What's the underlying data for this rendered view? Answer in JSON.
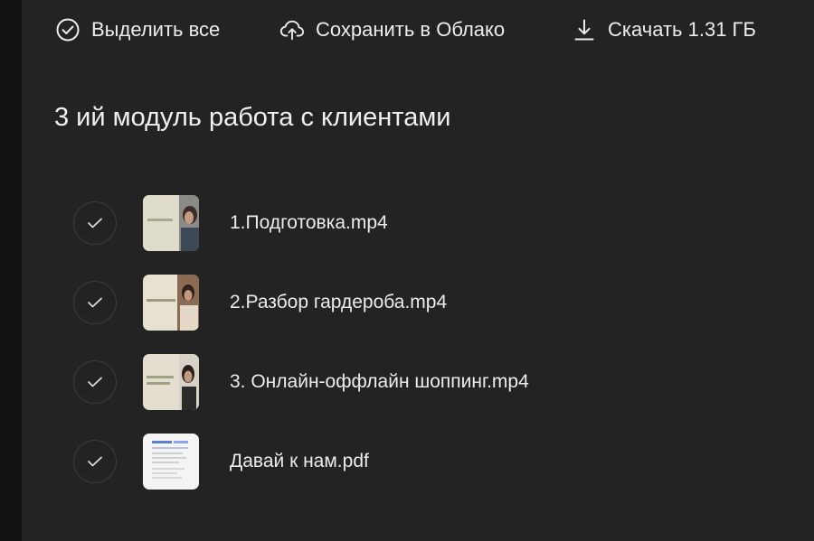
{
  "toolbar": {
    "select_all_label": "Выделить все",
    "save_cloud_label": "Сохранить в Облако",
    "download_label": "Скачать 1.31 ГБ",
    "icons": [
      "check-circle-icon",
      "cloud-upload-icon",
      "download-icon"
    ]
  },
  "folder": {
    "title": "3 ий модуль работа с клиентами"
  },
  "files": [
    {
      "name": "1.Подготовка.mp4",
      "type": "video",
      "thumb_icon": "video-thumbnail"
    },
    {
      "name": "2.Разбор гардероба.mp4",
      "type": "video",
      "thumb_icon": "video-thumbnail"
    },
    {
      "name": "3. Онлайн-оффлайн шоппинг.mp4",
      "type": "video",
      "thumb_icon": "video-thumbnail"
    },
    {
      "name": "Давай к нам.pdf",
      "type": "pdf",
      "thumb_icon": "pdf-thumbnail"
    }
  ],
  "colors": {
    "background": "#232323",
    "text": "#ececec",
    "check_border": "#3c3c3c"
  }
}
